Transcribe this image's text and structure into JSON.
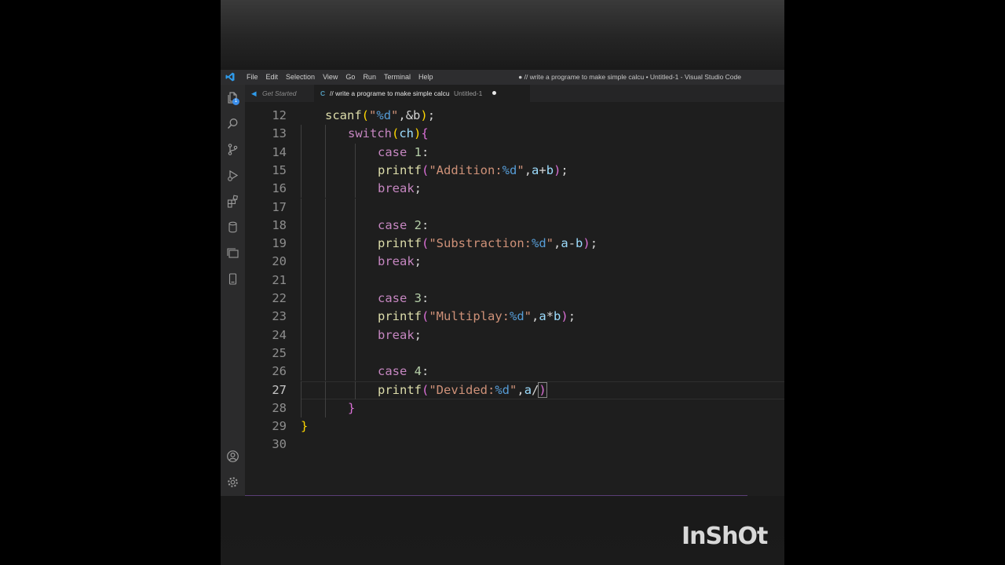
{
  "titlebar": {
    "menu": [
      "File",
      "Edit",
      "Selection",
      "View",
      "Go",
      "Run",
      "Terminal",
      "Help"
    ],
    "window_title": "● // write a programe to make simple calcu • Untitled-1 - Visual Studio Code"
  },
  "activity_badge": "1",
  "tabs": {
    "get_started": "Get Started",
    "active_icon": "C",
    "active_label": "// write a programe to make simple calcu",
    "active_suffix": "Untitled-1"
  },
  "code_lines": [
    {
      "n": "12",
      "indent": 1,
      "tokens": [
        [
          "fn",
          "scanf"
        ],
        [
          "br-y",
          "("
        ],
        [
          "str",
          "\""
        ],
        [
          "fmt",
          "%d"
        ],
        [
          "str",
          "\""
        ],
        [
          "d",
          ","
        ],
        [
          "d",
          "&b"
        ],
        [
          "br-y",
          ")"
        ],
        [
          "d",
          ";"
        ]
      ]
    },
    {
      "n": "13",
      "indent": 2,
      "tokens": [
        [
          "kw",
          "switch"
        ],
        [
          "br-y",
          "("
        ],
        [
          "var",
          "ch"
        ],
        [
          "br-y",
          ")"
        ],
        [
          "br-p",
          "{"
        ]
      ]
    },
    {
      "n": "14",
      "indent": 3,
      "tokens": [
        [
          "kw",
          "case"
        ],
        [
          "d",
          " "
        ],
        [
          "num",
          "1"
        ],
        [
          "d",
          ":"
        ]
      ]
    },
    {
      "n": "15",
      "indent": 3,
      "tokens": [
        [
          "fn",
          "printf"
        ],
        [
          "br-p",
          "("
        ],
        [
          "str",
          "\"Addition:"
        ],
        [
          "fmt",
          "%d"
        ],
        [
          "str",
          "\""
        ],
        [
          "d",
          ","
        ],
        [
          "var",
          "a"
        ],
        [
          "d",
          "+"
        ],
        [
          "var",
          "b"
        ],
        [
          "br-p",
          ")"
        ],
        [
          "d",
          ";"
        ]
      ]
    },
    {
      "n": "16",
      "indent": 3,
      "tokens": [
        [
          "kw",
          "break"
        ],
        [
          "d",
          ";"
        ]
      ]
    },
    {
      "n": "17",
      "indent": 3,
      "tokens": []
    },
    {
      "n": "18",
      "indent": 3,
      "tokens": [
        [
          "kw",
          "case"
        ],
        [
          "d",
          " "
        ],
        [
          "num",
          "2"
        ],
        [
          "d",
          ":"
        ]
      ]
    },
    {
      "n": "19",
      "indent": 3,
      "tokens": [
        [
          "fn",
          "printf"
        ],
        [
          "br-p",
          "("
        ],
        [
          "str",
          "\"Substraction:"
        ],
        [
          "fmt",
          "%d"
        ],
        [
          "str",
          "\""
        ],
        [
          "d",
          ","
        ],
        [
          "var",
          "a"
        ],
        [
          "d",
          "-"
        ],
        [
          "var",
          "b"
        ],
        [
          "br-p",
          ")"
        ],
        [
          "d",
          ";"
        ]
      ]
    },
    {
      "n": "20",
      "indent": 3,
      "tokens": [
        [
          "kw",
          "break"
        ],
        [
          "d",
          ";"
        ]
      ]
    },
    {
      "n": "21",
      "indent": 3,
      "tokens": []
    },
    {
      "n": "22",
      "indent": 3,
      "tokens": [
        [
          "kw",
          "case"
        ],
        [
          "d",
          " "
        ],
        [
          "num",
          "3"
        ],
        [
          "d",
          ":"
        ]
      ]
    },
    {
      "n": "23",
      "indent": 3,
      "tokens": [
        [
          "fn",
          "printf"
        ],
        [
          "br-p",
          "("
        ],
        [
          "str",
          "\"Multiplay:"
        ],
        [
          "fmt",
          "%d"
        ],
        [
          "str",
          "\""
        ],
        [
          "d",
          ","
        ],
        [
          "var",
          "a"
        ],
        [
          "d",
          "*"
        ],
        [
          "var",
          "b"
        ],
        [
          "br-p",
          ")"
        ],
        [
          "d",
          ";"
        ]
      ]
    },
    {
      "n": "24",
      "indent": 3,
      "tokens": [
        [
          "kw",
          "break"
        ],
        [
          "d",
          ";"
        ]
      ]
    },
    {
      "n": "25",
      "indent": 3,
      "tokens": []
    },
    {
      "n": "26",
      "indent": 3,
      "tokens": [
        [
          "kw",
          "case"
        ],
        [
          "d",
          " "
        ],
        [
          "num",
          "4"
        ],
        [
          "d",
          ":"
        ]
      ]
    },
    {
      "n": "27",
      "indent": 3,
      "active": true,
      "tokens": [
        [
          "fn",
          "printf"
        ],
        [
          "br-p",
          "("
        ],
        [
          "str",
          "\"Devided:"
        ],
        [
          "fmt",
          "%d"
        ],
        [
          "str",
          "\""
        ],
        [
          "d",
          ","
        ],
        [
          "var",
          "a"
        ],
        [
          "d",
          "/"
        ],
        [
          "br-p",
          ")"
        ]
      ]
    },
    {
      "n": "28",
      "indent": 2,
      "tokens": [
        [
          "br-p",
          "}"
        ]
      ]
    },
    {
      "n": "29",
      "indent": 0,
      "tokens": [
        [
          "br-y",
          "}"
        ]
      ]
    },
    {
      "n": "30",
      "indent": 0,
      "tokens": []
    }
  ],
  "watermark": "InShOt"
}
